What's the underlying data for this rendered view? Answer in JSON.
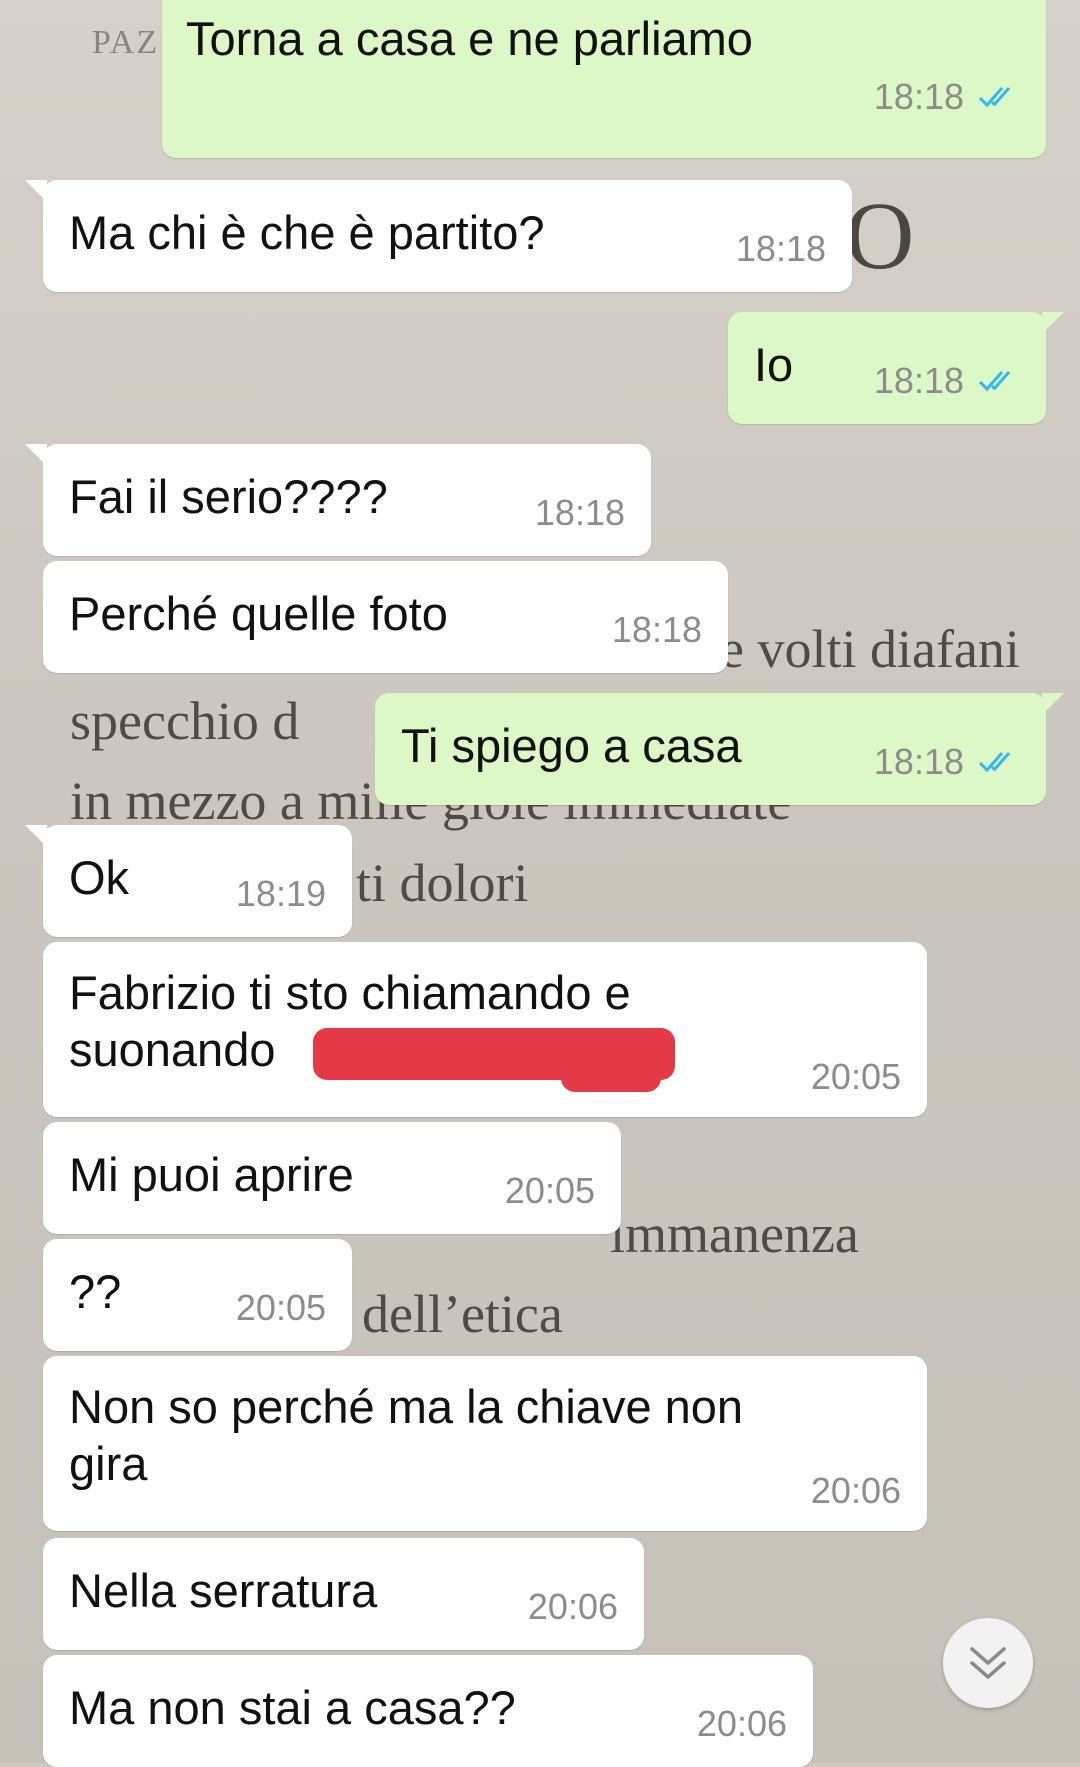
{
  "background_page": {
    "header": "PAZ",
    "lines": [
      "e volti diafani",
      "specchio d",
      "in mezzo a mille gioie immediate",
      "ti dolori",
      "immanenza",
      "dell’etica"
    ]
  },
  "messages": [
    {
      "dir": "out",
      "text": "Torna a casa e ne parliamo",
      "time": "18:18",
      "read": true
    },
    {
      "dir": "in",
      "text": "Ma chi è che è partito?",
      "time": "18:18"
    },
    {
      "dir": "out",
      "text": "Io",
      "time": "18:18",
      "read": true
    },
    {
      "dir": "in",
      "text": "Fai il serio????",
      "time": "18:18"
    },
    {
      "dir": "in",
      "text": "Perché quelle foto",
      "time": "18:18"
    },
    {
      "dir": "out",
      "text": "Ti spiego a casa",
      "time": "18:18",
      "read": true
    },
    {
      "dir": "in",
      "text": "Ok",
      "time": "18:19"
    },
    {
      "dir": "in",
      "text": "Fabrizio ti sto chiamando e\nsuonando",
      "time": "20:05",
      "redacted": true
    },
    {
      "dir": "in",
      "text": "Mi puoi aprire",
      "time": "20:05"
    },
    {
      "dir": "in",
      "text": "??",
      "time": "20:05"
    },
    {
      "dir": "in",
      "text": "Non so perché ma la chiave non\ngira",
      "time": "20:06"
    },
    {
      "dir": "in",
      "text": "Nella serratura",
      "time": "20:06"
    },
    {
      "dir": "in",
      "text": "Ma non stai a casa??",
      "time": "20:06"
    }
  ],
  "colors": {
    "outgoing_bubble": "#dcf8c6",
    "incoming_bubble": "#ffffff",
    "read_ticks": "#34b7f1",
    "redaction": "#e43a47"
  },
  "icons": {
    "read_receipt": "double-check-icon",
    "scroll_down": "chevrons-down-icon"
  }
}
